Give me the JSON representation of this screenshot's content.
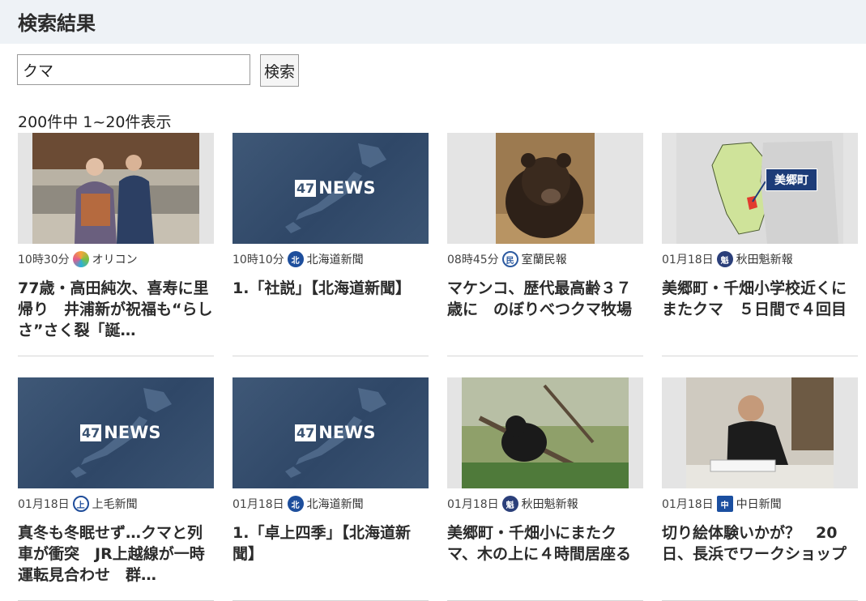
{
  "page": {
    "title": "検索結果"
  },
  "search": {
    "value": "クマ",
    "button_label": "検索"
  },
  "result_count": "200件中 1~20件表示",
  "cards": [
    {
      "time": "10時30分",
      "source": "オリコン",
      "logo": "oricon-logo-icon",
      "title": "77歳・高田純次、喜寿に里帰り　井浦新が祝福も“らしさ”さく裂「誕…",
      "thumb": "photo-two-men"
    },
    {
      "time": "10時10分",
      "source": "北海道新聞",
      "logo": "hokkaido-shimbun-logo-icon",
      "title": "1.「社説」【北海道新聞】",
      "thumb": "47news",
      "thumb_text": "47NEWS"
    },
    {
      "time": "08時45分",
      "source": "室蘭民報",
      "logo": "muroran-minpo-logo-icon",
      "title": "マケンコ、歴代最高齢３７歳に　のぼりべつクマ牧場",
      "thumb": "photo-bear"
    },
    {
      "time": "01月18日",
      "source": "秋田魁新報",
      "logo": "akita-sakigake-logo-icon",
      "title": "美郷町・千畑小学校近くにまたクマ　５日間で４回目",
      "thumb": "map-misato",
      "thumb_text": "美郷町"
    },
    {
      "time": "01月18日",
      "source": "上毛新聞",
      "logo": "jomo-shimbun-logo-icon",
      "title": "真冬も冬眠せず…クマと列車が衝突　JR上越線が一時運転見合わせ　群…",
      "thumb": "47news",
      "thumb_text": "47NEWS"
    },
    {
      "time": "01月18日",
      "source": "北海道新聞",
      "logo": "hokkaido-shimbun-logo-icon",
      "title": "1.「卓上四季」【北海道新聞】",
      "thumb": "47news",
      "thumb_text": "47NEWS"
    },
    {
      "time": "01月18日",
      "source": "秋田魁新報",
      "logo": "akita-sakigake-logo-icon",
      "title": "美郷町・千畑小にまたクマ、木の上に４時間居座る",
      "thumb": "photo-bear-tree"
    },
    {
      "time": "01月18日",
      "source": "中日新聞",
      "logo": "chunichi-shimbun-logo-icon",
      "title": "切り絵体験いかが？　20日、長浜でワークショップ",
      "thumb": "photo-man-desk"
    }
  ]
}
